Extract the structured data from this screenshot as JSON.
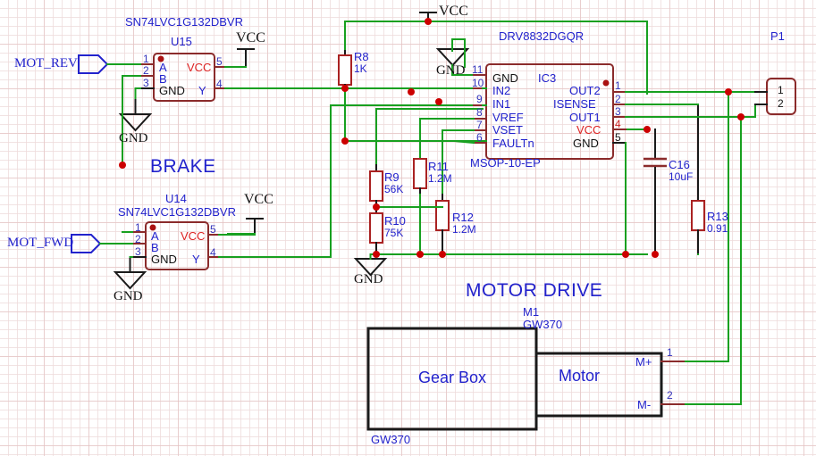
{
  "sheet": {
    "sections": [
      {
        "name": "brake",
        "label": "BRAKE"
      },
      {
        "name": "motor_drive",
        "label": "MOTOR DRIVE"
      }
    ],
    "power_label": "VCC",
    "ground_label": "GND"
  },
  "ports": [
    {
      "name": "mot_rev",
      "label": "MOT_REV"
    },
    {
      "name": "mot_fwd",
      "label": "MOT_FWD"
    }
  ],
  "ics": [
    {
      "id": "u15",
      "refdes": "U15",
      "part": "SN74LVC1G132DBVR",
      "pins_left": [
        {
          "num": "1",
          "name": "A"
        },
        {
          "num": "2",
          "name": "B"
        },
        {
          "num": "3",
          "name": "GND"
        }
      ],
      "pins_right": [
        {
          "num": "5",
          "name": "VCC"
        },
        {
          "num": "4",
          "name": "Y"
        }
      ]
    },
    {
      "id": "u14",
      "refdes": "U14",
      "part": "SN74LVC1G132DBVR",
      "pins_left": [
        {
          "num": "1",
          "name": "A"
        },
        {
          "num": "2",
          "name": "B"
        },
        {
          "num": "3",
          "name": "GND"
        }
      ],
      "pins_right": [
        {
          "num": "5",
          "name": "VCC"
        },
        {
          "num": "4",
          "name": "Y"
        }
      ]
    },
    {
      "id": "ic3",
      "refdes": "IC3",
      "part": "DRV8832DGQR",
      "footprint": "MSOP-10-EP",
      "pins_left": [
        {
          "num": "11",
          "name": "GND"
        },
        {
          "num": "10",
          "name": "IN2"
        },
        {
          "num": "9",
          "name": "IN1"
        },
        {
          "num": "8",
          "name": "VREF"
        },
        {
          "num": "7",
          "name": "VSET"
        },
        {
          "num": "6",
          "name": "FAULTn"
        }
      ],
      "pins_right": [
        {
          "num": "1",
          "name": "OUT2"
        },
        {
          "num": "2",
          "name": "ISENSE"
        },
        {
          "num": "3",
          "name": "OUT1"
        },
        {
          "num": "4",
          "name": "VCC"
        },
        {
          "num": "5",
          "name": "GND"
        }
      ]
    }
  ],
  "resistors": [
    {
      "refdes": "R8",
      "value": "1K"
    },
    {
      "refdes": "R9",
      "value": "56K"
    },
    {
      "refdes": "R10",
      "value": "75K"
    },
    {
      "refdes": "R11",
      "value": "1.2M"
    },
    {
      "refdes": "R12",
      "value": "1.2M"
    },
    {
      "refdes": "R13",
      "value": "0.91"
    }
  ],
  "capacitors": [
    {
      "refdes": "C16",
      "value": "10uF"
    }
  ],
  "connectors": [
    {
      "refdes": "P1",
      "pins": [
        {
          "num": "1"
        },
        {
          "num": "2"
        }
      ]
    }
  ],
  "motor": {
    "refdes": "M1",
    "part": "GW370",
    "gearbox_label": "Gear Box",
    "gearbox_part": "GW370",
    "motor_label": "Motor",
    "terminals": [
      {
        "name": "M+",
        "num": "1"
      },
      {
        "name": "M-",
        "num": "2"
      }
    ]
  },
  "colors": {
    "wire": "#18a020",
    "pin": "#8b2b2b",
    "text_blue": "#2222cc",
    "text_red": "#dd2222",
    "junction": "#cc0000"
  }
}
